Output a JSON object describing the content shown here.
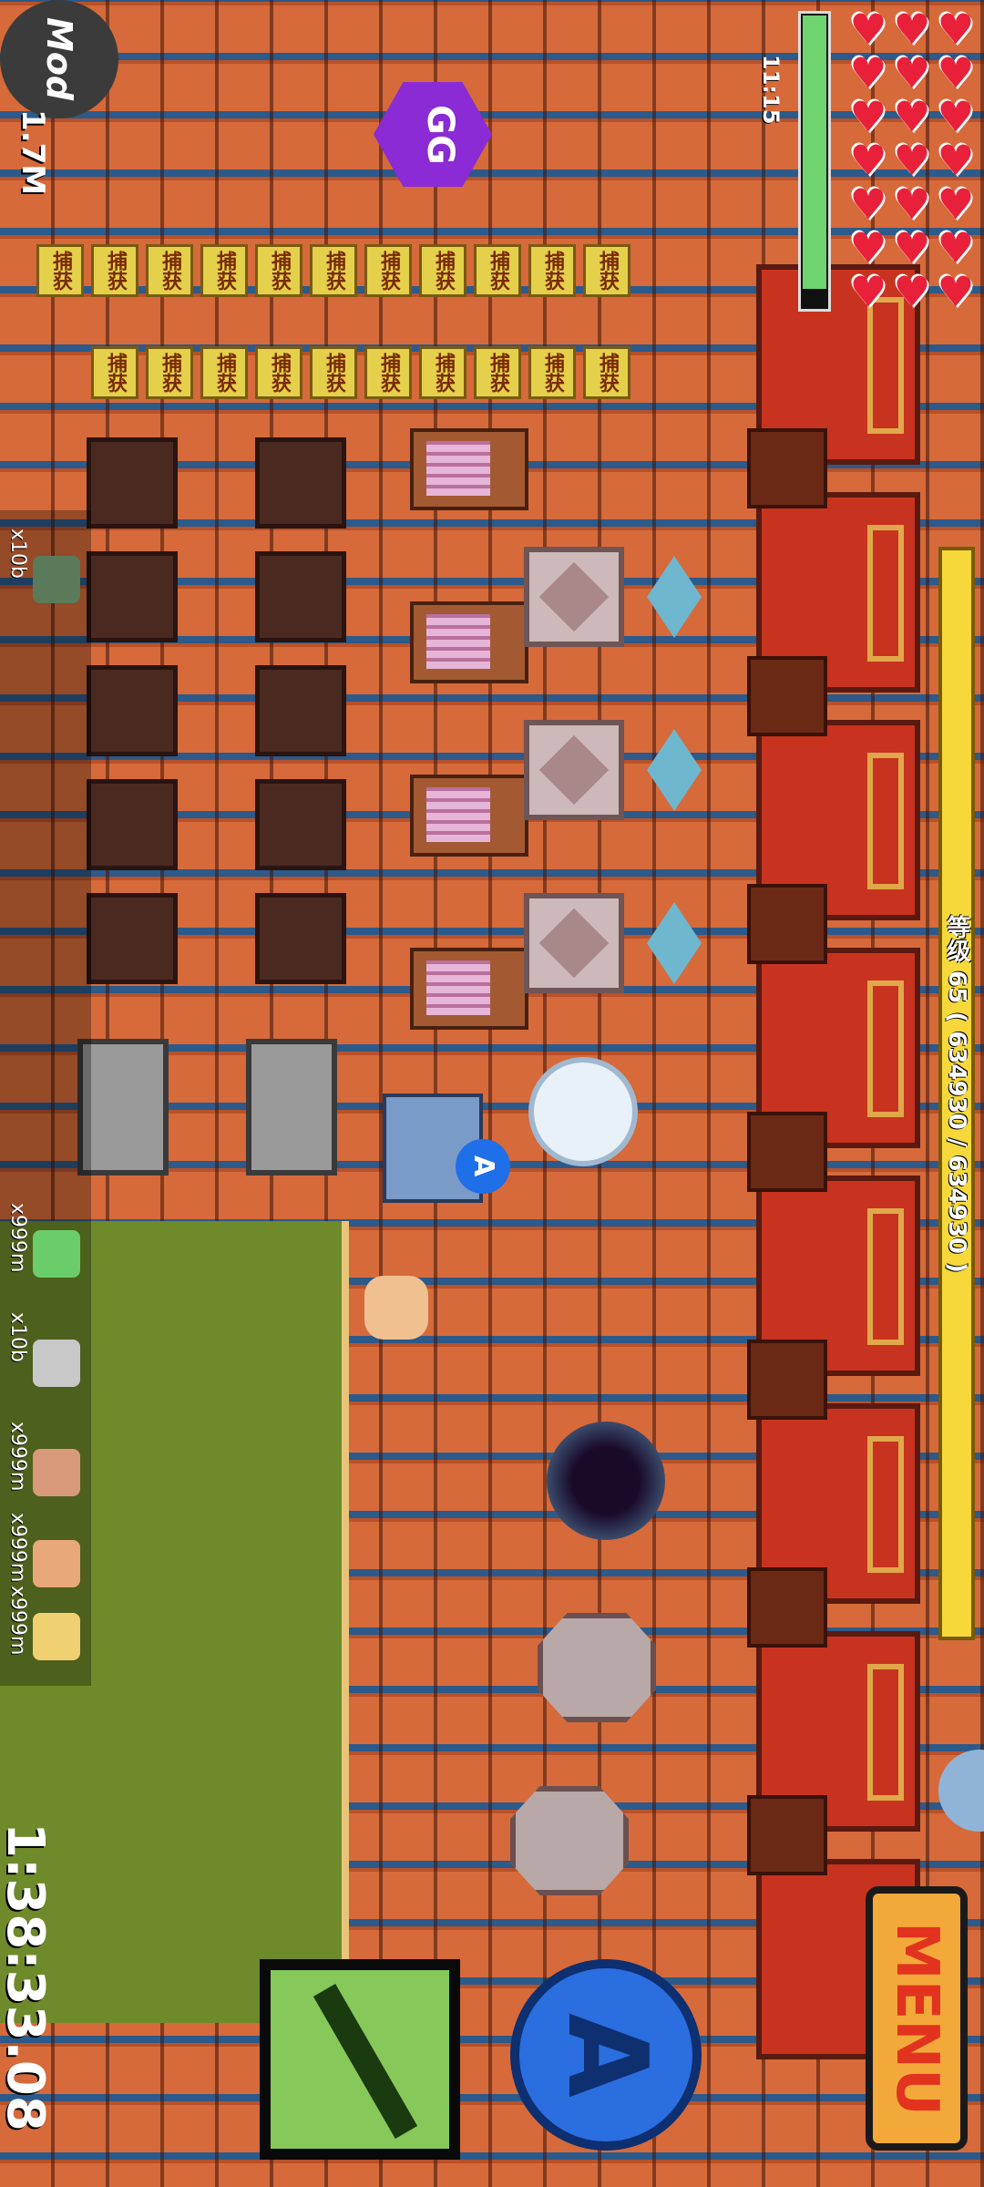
{
  "hud": {
    "level_text": "等级 65 ( 634930 / 634930 )",
    "clock": "11:15",
    "mod_label": "Mod",
    "money": "1.7M",
    "timer": "1:38:33.08",
    "menu_label": "MENU",
    "attack_label": "A",
    "player_tag": "A",
    "gg_label": "GG",
    "hp_hearts": 21
  },
  "capture_label": "捕获",
  "hotbar": [
    {
      "count": "x10b",
      "icon": "pickaxe-icon"
    },
    {
      "count": "x999m",
      "icon": "potion-icon"
    },
    {
      "count": "x10b",
      "icon": "bucket-icon"
    },
    {
      "count": "x999m",
      "icon": "shirt-icon"
    },
    {
      "count": "x999m",
      "icon": "shirt-icon-2"
    },
    {
      "count": "x999m",
      "icon": "bread-icon"
    }
  ],
  "colors": {
    "xp_bar": "#f6d83a",
    "hp_fill": "#6fd36f",
    "heart": "#e8203a",
    "menu_bg": "#f2a93a",
    "attack_bg": "#2a6ee0"
  }
}
